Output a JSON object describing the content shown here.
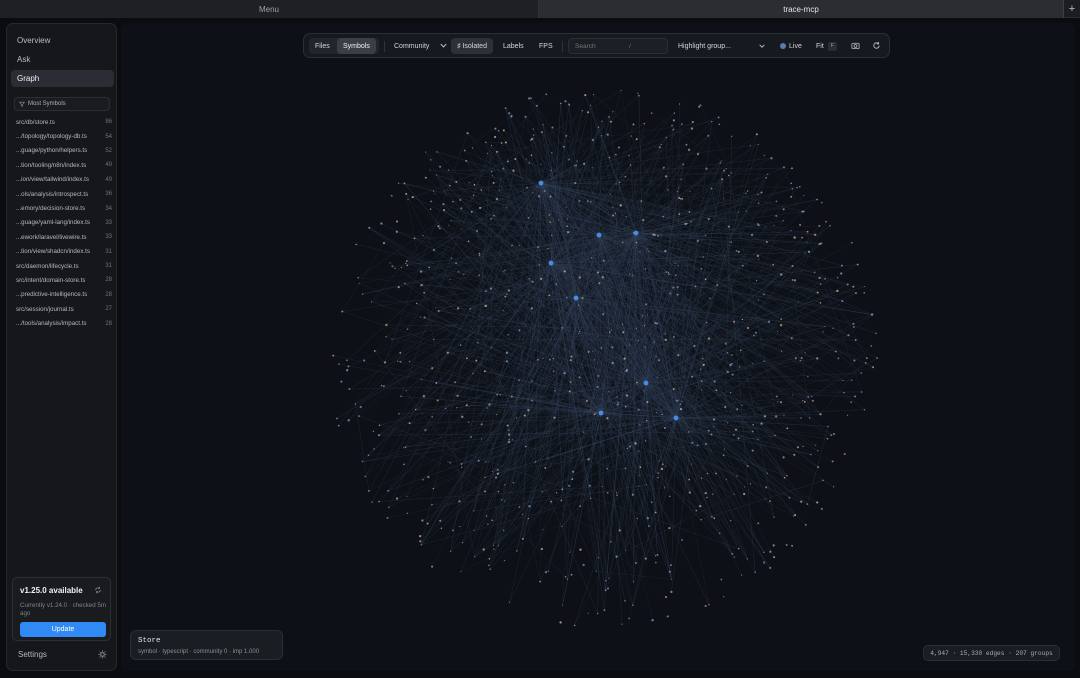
{
  "tabs": {
    "menu": "Menu",
    "active": "trace-mcp",
    "new_tab": "+"
  },
  "sidebar": {
    "nav": [
      {
        "label": "Overview",
        "active": false
      },
      {
        "label": "Ask",
        "active": false
      },
      {
        "label": "Graph",
        "active": true
      }
    ],
    "filter_label": "Most Symbols",
    "files": [
      {
        "name": "src/db/store.ts",
        "count": "86"
      },
      {
        "name": ".../topology/topology-db.ts",
        "count": "54"
      },
      {
        "name": "...guage/python/helpers.ts",
        "count": "52"
      },
      {
        "name": "...tion/tooling/n8n/index.ts",
        "count": "49"
      },
      {
        "name": "...ion/view/tailwind/index.ts",
        "count": "49"
      },
      {
        "name": "...ols/analysis/introspect.ts",
        "count": "36"
      },
      {
        "name": "...emory/decision-store.ts",
        "count": "34"
      },
      {
        "name": "...guage/yaml-lang/index.ts",
        "count": "33"
      },
      {
        "name": "...ework/laravel/livewire.ts",
        "count": "33"
      },
      {
        "name": "...tion/view/shadcn/index.ts",
        "count": "31"
      },
      {
        "name": "src/daemon/lifecycle.ts",
        "count": "31"
      },
      {
        "name": "src/intent/domain-store.ts",
        "count": "28"
      },
      {
        "name": "...predictive-intelligence.ts",
        "count": "28"
      },
      {
        "name": "src/session/journal.ts",
        "count": "27"
      },
      {
        "name": ".../tools/analysis/impact.ts",
        "count": "28"
      }
    ],
    "update": {
      "title": "v1.25.0 available",
      "text": "Currently v1.24.0 · checked 5m ago",
      "button": "Update"
    },
    "settings_label": "Settings"
  },
  "toolbar": {
    "files": "Files",
    "symbols": "Symbols",
    "community": "Community",
    "isolated": "♯ Isolated",
    "labels": "Labels",
    "fps": "FPS",
    "search_placeholder": "Search",
    "search_shortcut": "/",
    "highlight": "Highlight group...",
    "live": "Live",
    "fit": "Fit",
    "fit_shortcut": "F"
  },
  "selected_node": {
    "name": "Store",
    "meta": "symbol · typescript · community 0 · imp 1.000"
  },
  "stats": "4,947 · 15,330 edges · 207 groups",
  "colors": {
    "accent": "#2f8af5",
    "edge": "#3b4a63",
    "node_blue": "#5b8fd6",
    "node_warm": "#c49a7a",
    "hub": "#4c9bff"
  }
}
